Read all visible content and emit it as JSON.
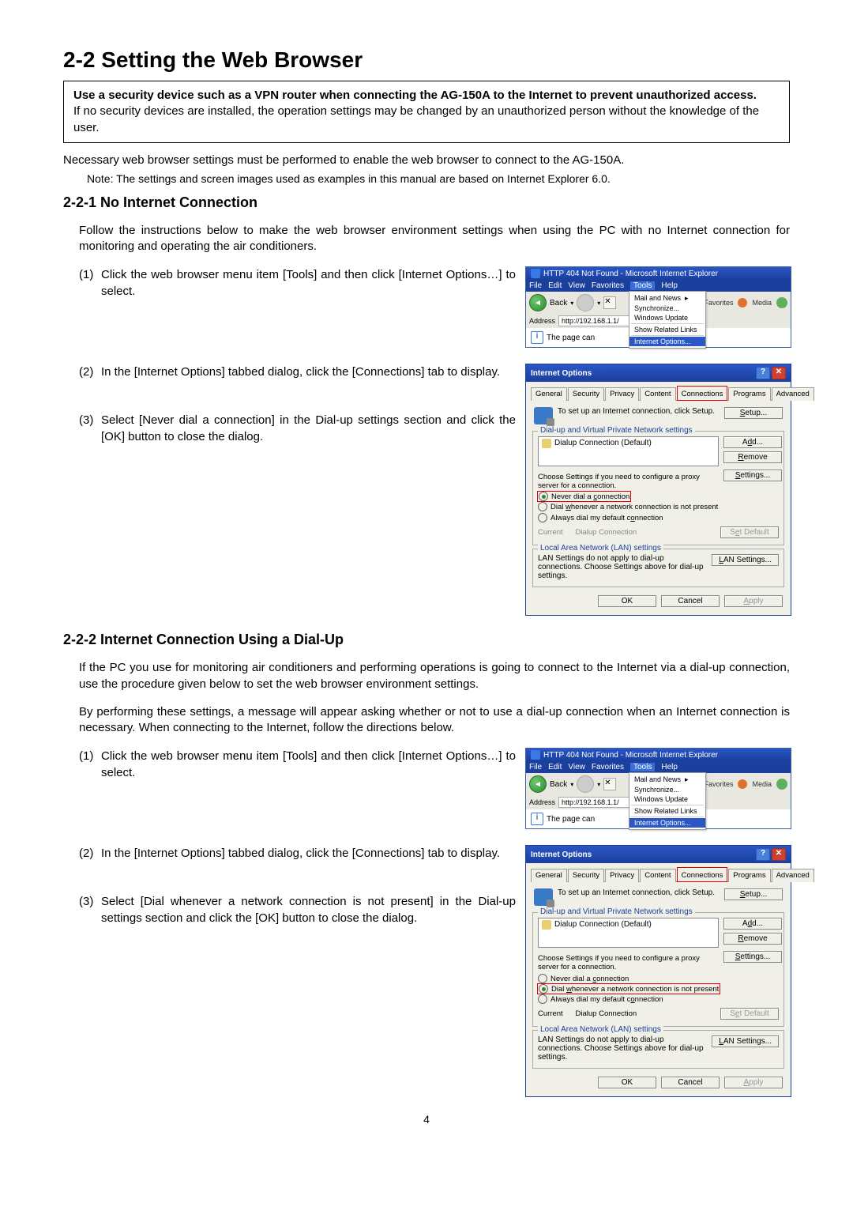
{
  "page_number": "4",
  "heading": "2-2 Setting the Web Browser",
  "warning": {
    "bold": "Use a security device such as a VPN router when connecting the AG-150A to the Internet to prevent unauthorized access.",
    "rest": "If no security devices are installed, the operation settings may be changed by an unauthorized person without the knowledge of the user."
  },
  "intro": "Necessary web browser settings must be performed to enable the web browser to connect to the AG-150A.",
  "note": "Note: The settings and screen images used as examples in this manual are based on Internet Explorer 6.0.",
  "sec221": {
    "title": "2-2-1 No Internet Connection",
    "body": "Follow the instructions below to make the web browser environment settings when using the PC with no Internet connection for monitoring and operating the air conditioners.",
    "step1": "Click the web browser menu item [Tools] and then click [Internet Options…] to select.",
    "step2": "In the [Internet Options] tabbed dialog, click the [Connections] tab to display.",
    "step3": "Select [Never dial a connection] in the Dial-up settings section and click the [OK] button to close the dialog."
  },
  "sec222": {
    "title": "2-2-2 Internet Connection Using a Dial-Up",
    "body1": "If the PC you use for monitoring air conditioners and performing operations is going to connect to the Internet via a dial-up connection, use the procedure given below to set the web browser environment settings.",
    "body2": "By performing these settings, a message will appear asking whether or not to use a dial-up connection when an Internet connection is necessary. When connecting to the Internet, follow the directions below.",
    "step1": "Click the web browser menu item [Tools] and then click [Internet Options…] to select.",
    "step2": "In the [Internet Options] tabbed dialog, click the [Connections] tab to display.",
    "step3": "Select [Dial whenever a network connection is not present] in the Dial-up settings section and click the [OK] button to close the dialog."
  },
  "ie": {
    "title": "HTTP 404 Not Found - Microsoft Internet Explorer",
    "menu_file": "File",
    "menu_edit": "Edit",
    "menu_view": "View",
    "menu_favorites": "Favorites",
    "menu_tools": "Tools",
    "menu_help": "Help",
    "back": "Back",
    "dd_mail": "Mail and News",
    "dd_sync": "Synchronize...",
    "dd_wu": "Windows Update",
    "dd_related": "Show Related Links",
    "dd_io": "Internet Options...",
    "fav": "Favorites",
    "media": "Media",
    "addr_label": "Address",
    "addr_url": "http://192.168.1.1/",
    "page_cannot": "The page can"
  },
  "dlg": {
    "title": "Internet Options",
    "tab_general": "General",
    "tab_security": "Security",
    "tab_privacy": "Privacy",
    "tab_content": "Content",
    "tab_connections": "Connections",
    "tab_programs": "Programs",
    "tab_advanced": "Advanced",
    "setup_text": "To set up an Internet connection, click Setup.",
    "setup_btn": "Setup...",
    "fs1_legend": "Dial-up and Virtual Private Network settings",
    "dial_entry": "Dialup Connection (Default)",
    "add": "Add...",
    "remove": "Remove",
    "choose": "Choose Settings if you need to configure a proxy server for a connection.",
    "settings": "Settings...",
    "r_never": "Never dial a connection",
    "r_dialwhen": "Dial whenever a network connection is not present",
    "r_always": "Always dial my default connection",
    "current_lbl": "Current",
    "current_val": "Dialup Connection",
    "set_default": "Set Default",
    "fs2_legend": "Local Area Network (LAN) settings",
    "lan_text": "LAN Settings do not apply to dial-up connections. Choose Settings above for dial-up settings.",
    "lan_btn": "LAN Settings...",
    "ok": "OK",
    "cancel": "Cancel",
    "apply": "Apply"
  }
}
